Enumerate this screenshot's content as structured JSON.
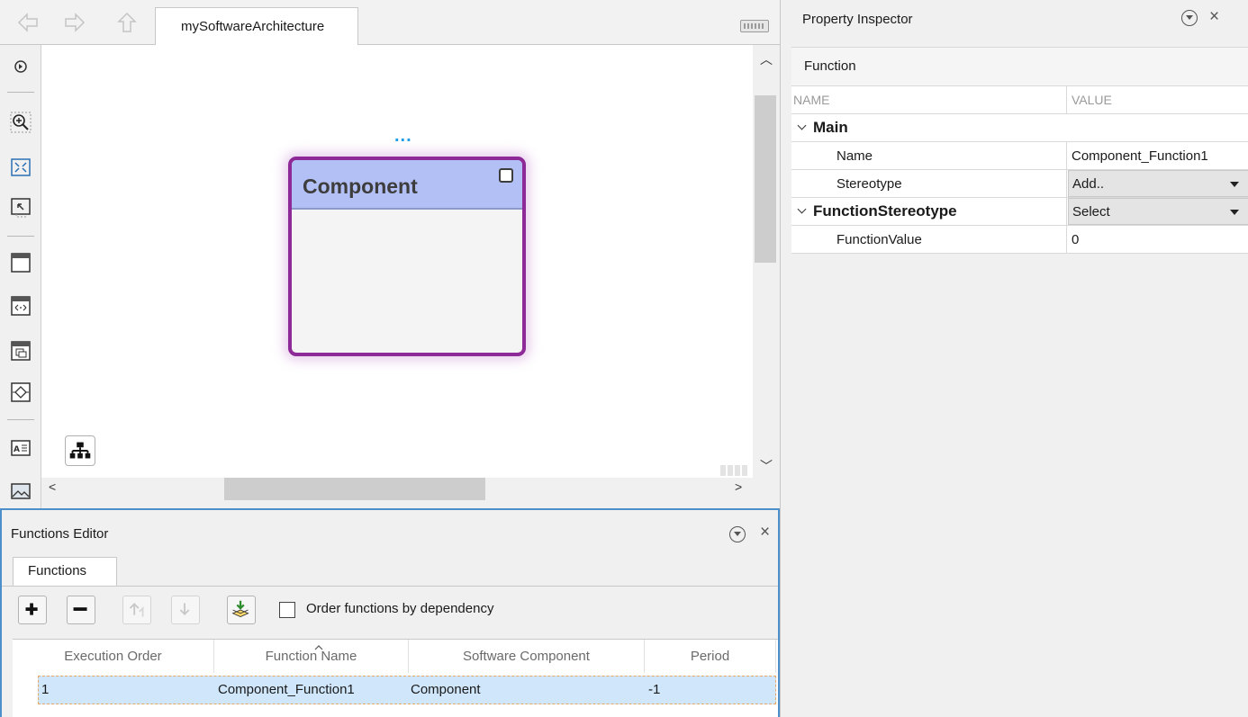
{
  "toolbar": {
    "tab_title": "mySoftwareArchitecture"
  },
  "canvas": {
    "component_name": "Component",
    "dots": "..."
  },
  "inspector": {
    "title": "Property Inspector",
    "section": "Function",
    "col_name": "NAME",
    "col_value": "VALUE",
    "groups": [
      {
        "label": "Main",
        "rows": [
          {
            "name": "Name",
            "value": "Component_Function1"
          },
          {
            "name": "Stereotype",
            "value": "Add.."
          }
        ]
      },
      {
        "label": "FunctionStereotype",
        "value": "Select",
        "rows": [
          {
            "name": "FunctionValue",
            "value": "0"
          }
        ]
      }
    ]
  },
  "functions_editor": {
    "title": "Functions Editor",
    "tab": "Functions",
    "order_checkbox_label": "Order functions by dependency",
    "order_checked": false,
    "columns": [
      "Execution Order",
      "Function Name",
      "Software Component",
      "Period"
    ],
    "rows": [
      {
        "order": "1",
        "name": "Component_Function1",
        "component": "Component",
        "period": "-1"
      }
    ]
  },
  "colors": {
    "component_border": "#8e2a97",
    "component_header": "#b3c0f5",
    "selection_row": "#cfe6fb",
    "editor_border": "#4d8fca"
  }
}
